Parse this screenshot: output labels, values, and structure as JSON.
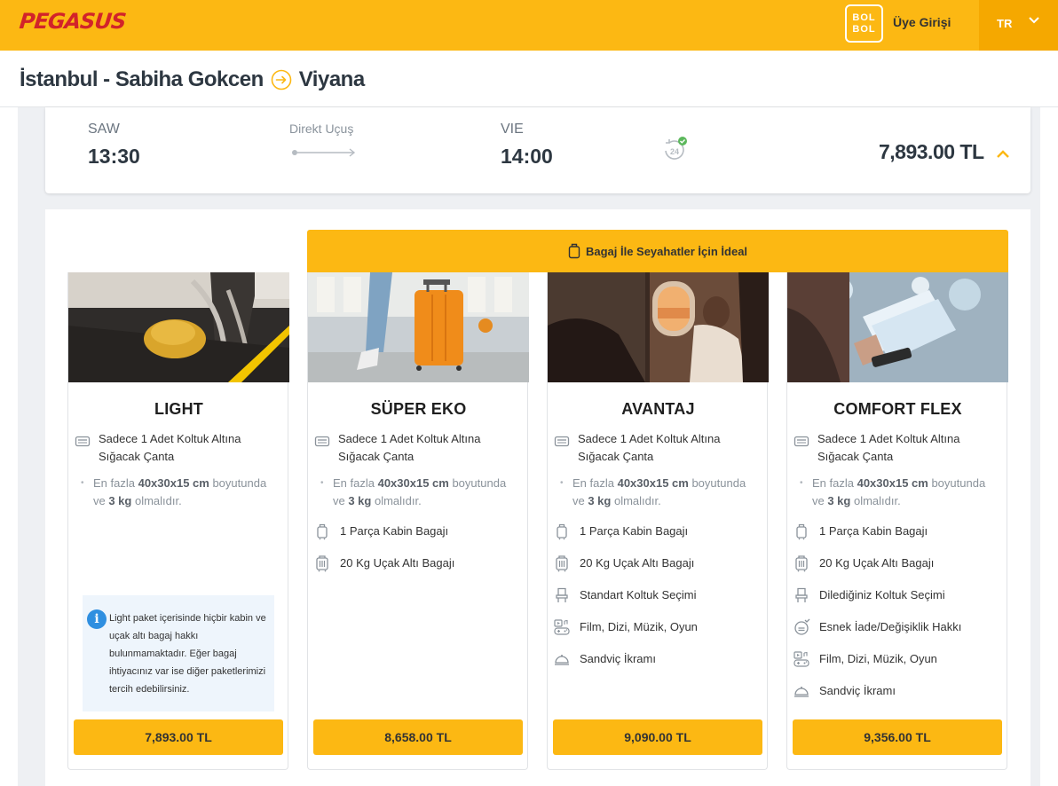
{
  "header": {
    "logo": "PEGASUS",
    "bolbol_top": "BOL",
    "bolbol_bottom": "BOL",
    "member_login": "Üye Girişi",
    "language": "TR"
  },
  "route": {
    "origin": "İstanbul - Sabiha Gokcen",
    "destination": "Viyana"
  },
  "flight": {
    "departure_code": "SAW",
    "departure_time": "13:30",
    "flight_type": "Direkt Uçuş",
    "arrival_code": "VIE",
    "arrival_time": "14:00",
    "icon_24": "24",
    "price": "7,893.00 TL"
  },
  "ideal_banner": "Bagaj İle Seyahatler İçin İdeal",
  "colors": {
    "brand_yellow": "#fcb813",
    "brand_red": "#d2232a",
    "info_blue": "#2f8fe0"
  },
  "common": {
    "bag_text": "Sadece 1 Adet Koltuk Altına Sığacak Çanta",
    "note_pre": "En fazla ",
    "note_size": "40x30x15 cm",
    "note_mid": " boyutunda ve ",
    "note_weight": "3 kg",
    "note_post": " olmalıdır."
  },
  "packages": [
    {
      "name": "LIGHT",
      "photo": "seat-bag-photo",
      "features": [],
      "info_icon": "i",
      "info_text": "Light paket içerisinde hiçbir kabin ve uçak altı bagaj hakkı bulunmamaktadır. Eğer bagaj ihtiyacınız var ise diğer paketlerimizi tercih edebilirsiniz.",
      "price": "7,893.00 TL"
    },
    {
      "name": "SÜPER EKO",
      "photo": "orange-suitcase-photo",
      "features": [
        {
          "icon": "cabin-bag-icon",
          "text": "1 Parça Kabin Bagajı"
        },
        {
          "icon": "checked-bag-icon",
          "text": "20 Kg Uçak Altı Bagajı"
        }
      ],
      "price": "8,658.00 TL"
    },
    {
      "name": "AVANTAJ",
      "photo": "window-passenger-photo",
      "features": [
        {
          "icon": "cabin-bag-icon",
          "text": "1 Parça Kabin Bagajı"
        },
        {
          "icon": "checked-bag-icon",
          "text": "20 Kg Uçak Altı Bagajı"
        },
        {
          "icon": "seat-icon",
          "text": "Standart Koltuk Seçimi"
        },
        {
          "icon": "entertainment-icon",
          "text": "Film, Dizi, Müzik, Oyun"
        },
        {
          "icon": "meal-icon",
          "text": "Sandviç İkramı"
        }
      ],
      "price": "9,090.00 TL"
    },
    {
      "name": "COMFORT FLEX",
      "photo": "boarding-pass-photo",
      "features": [
        {
          "icon": "cabin-bag-icon",
          "text": "1 Parça Kabin Bagajı"
        },
        {
          "icon": "checked-bag-icon",
          "text": "20 Kg Uçak Altı Bagajı"
        },
        {
          "icon": "seat-icon",
          "text": "Dilediğiniz Koltuk Seçimi"
        },
        {
          "icon": "refund-icon",
          "text": "Esnek İade/Değişiklik Hakkı"
        },
        {
          "icon": "entertainment-icon",
          "text": "Film, Dizi, Müzik, Oyun"
        },
        {
          "icon": "meal-icon",
          "text": "Sandviç İkramı"
        }
      ],
      "price": "9,356.00 TL"
    }
  ]
}
